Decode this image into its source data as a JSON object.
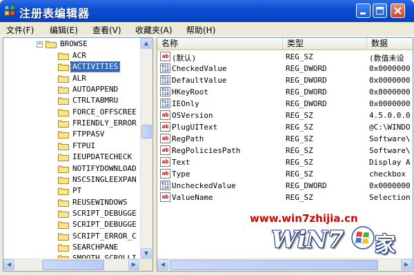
{
  "window": {
    "title": "注册表编辑器"
  },
  "menu": [
    {
      "label": "文件(F)"
    },
    {
      "label": "编辑(E)"
    },
    {
      "label": "查看(V)"
    },
    {
      "label": "收藏夹(A)"
    },
    {
      "label": "帮助(H)"
    }
  ],
  "tree": {
    "parent": "BROWSE",
    "items": [
      {
        "label": "ACR",
        "selected": false
      },
      {
        "label": "ACTIVITIES",
        "selected": true
      },
      {
        "label": "ALR",
        "selected": false
      },
      {
        "label": "AUTOAPPEND",
        "selected": false
      },
      {
        "label": "CTRLTABMRU",
        "selected": false
      },
      {
        "label": "FORCE_OFFSCREE",
        "selected": false
      },
      {
        "label": "FRIENDLY_ERROR",
        "selected": false
      },
      {
        "label": "FTPPASV",
        "selected": false
      },
      {
        "label": "FTPUI",
        "selected": false
      },
      {
        "label": "IEUPDATECHECK",
        "selected": false
      },
      {
        "label": "NOTIFYDOWNLOAD",
        "selected": false
      },
      {
        "label": "NSCSINGLEEXPAN",
        "selected": false
      },
      {
        "label": "PT",
        "selected": false
      },
      {
        "label": "REUSEWINDOWS",
        "selected": false
      },
      {
        "label": "SCRIPT_DEBUGGE",
        "selected": false
      },
      {
        "label": "SCRIPT_DEBUGGE",
        "selected": false
      },
      {
        "label": "SCRIPT_ERROR_C",
        "selected": false
      },
      {
        "label": "SEARCHPANE",
        "selected": false
      },
      {
        "label": "SMOOTH_SCROLLI",
        "selected": false
      }
    ]
  },
  "list": {
    "columns": [
      "名称",
      "类型",
      "数据"
    ],
    "rows": [
      {
        "name": "(默认)",
        "type": "REG_SZ",
        "data": "(数值未设",
        "kind": "sz"
      },
      {
        "name": "CheckedValue",
        "type": "REG_DWORD",
        "data": "0x0000000",
        "kind": "dw"
      },
      {
        "name": "DefaultValue",
        "type": "REG_DWORD",
        "data": "0x0000000",
        "kind": "dw"
      },
      {
        "name": "HKeyRoot",
        "type": "REG_DWORD",
        "data": "0x8000000",
        "kind": "dw"
      },
      {
        "name": "IEOnly",
        "type": "REG_DWORD",
        "data": "0x0000000",
        "kind": "dw"
      },
      {
        "name": "OSVersion",
        "type": "REG_SZ",
        "data": "4.5.0.0.0",
        "kind": "sz"
      },
      {
        "name": "PlugUIText",
        "type": "REG_SZ",
        "data": "@C:\\WINDO",
        "kind": "sz"
      },
      {
        "name": "RegPath",
        "type": "REG_SZ",
        "data": "Software\\",
        "kind": "sz"
      },
      {
        "name": "RegPoliciesPath",
        "type": "REG_SZ",
        "data": "Software\\",
        "kind": "sz"
      },
      {
        "name": "Text",
        "type": "REG_SZ",
        "data": "Display A",
        "kind": "sz"
      },
      {
        "name": "Type",
        "type": "REG_SZ",
        "data": "checkbox",
        "kind": "sz"
      },
      {
        "name": "UncheckedValue",
        "type": "REG_DWORD",
        "data": "0x0000000",
        "kind": "dw"
      },
      {
        "name": "ValueName",
        "type": "REG_SZ",
        "data": "Selection",
        "kind": "sz"
      }
    ]
  },
  "icons": {
    "string_value": "ab",
    "binary_value": "011\n110"
  },
  "watermark": {
    "url": "www.win7zhijia.cn",
    "brand": "WiN7",
    "suffix": "家"
  },
  "colors": {
    "selection": "#316ac5",
    "titlebar": "#0a4fd1",
    "watermark": "#d40000"
  }
}
